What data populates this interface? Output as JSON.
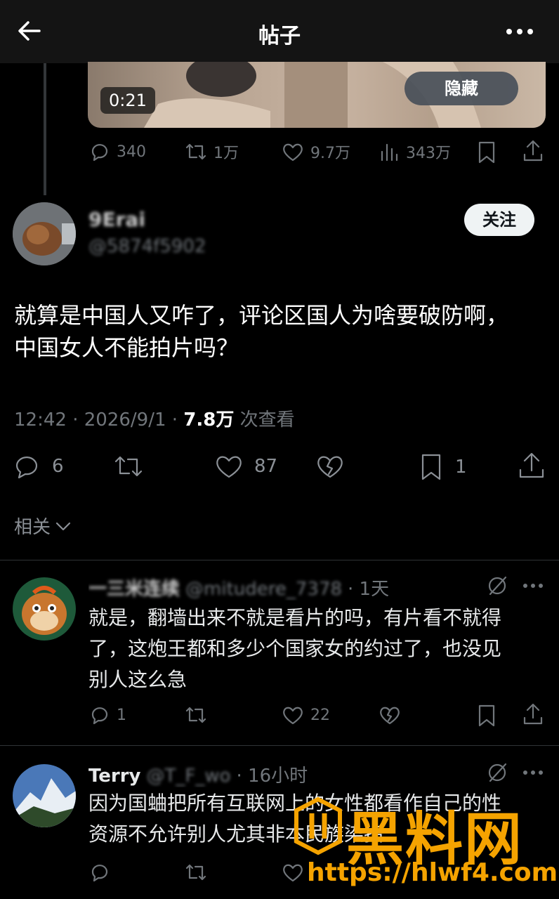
{
  "header": {
    "title": "帖子",
    "back_icon": "back-arrow-icon",
    "more_icon": "more-icon"
  },
  "video": {
    "duration": "0:21",
    "hide_label": "隐藏"
  },
  "parent_stats": {
    "replies": "340",
    "retweets": "1万",
    "likes": "9.7万",
    "views": "343万"
  },
  "post": {
    "author_name": "9Erai",
    "author_handle": "@5874f5902",
    "follow_label": "关注",
    "text_line1": "就算是中国人又咋了，评论区国人为啥要破防啊，",
    "text_line2": "中国女人不能拍片吗？",
    "time": "12:42 · 2026/9/1 · ",
    "views": "7.8万",
    "views_suffix": " 次查看",
    "replies": "6",
    "likes": "87",
    "bookmarks": "1"
  },
  "related": {
    "label": "相关"
  },
  "replies": [
    {
      "name": "一三米连续",
      "handle": "@mitudere_7378",
      "time": "· 1天",
      "text_line1": "就是，翻墙出来不就是看片的吗，有片看不就得",
      "text_line2": "了，这炮王都和多少个国家女的约过了，也没见",
      "text_line3": "别人这么急",
      "reply_count": "1",
      "like_count": "22"
    },
    {
      "name": "Terry",
      "handle": "@T_F_wo",
      "time": "· 16小时",
      "text_line1": "因为国蛐把所有互联网上的女性都看作自己的性",
      "text_line2": "资源不允许别人尤其非本民族染指"
    }
  ],
  "watermark": {
    "title": "黑料网",
    "url": "https://hlwf4.com"
  },
  "colors": {
    "accent_watermark": "#f5a300",
    "background": "#000000",
    "muted": "#71767b"
  }
}
